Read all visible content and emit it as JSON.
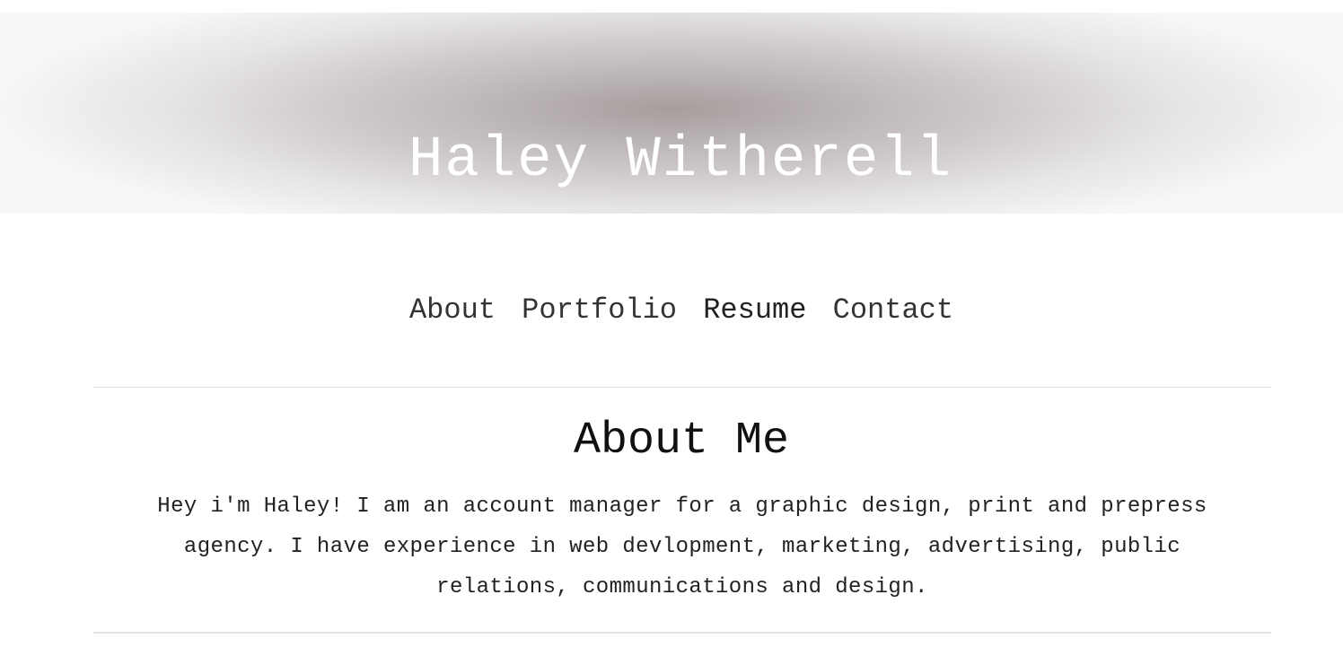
{
  "hero": {
    "title": "Haley Witherell"
  },
  "nav": {
    "items": [
      {
        "label": "About"
      },
      {
        "label": "Portfolio"
      },
      {
        "label": "Resume"
      },
      {
        "label": "Contact"
      }
    ]
  },
  "about": {
    "heading": "About Me",
    "text": "Hey i'm Haley! I am an account manager for a graphic design, print and prepress agency. I have experience in web devlopment, marketing, advertising, public relations, communications and design."
  },
  "colors": {
    "hero_center": "#a79e9e",
    "hero_edge": "#f7f7f7",
    "text": "#222222",
    "rule": "#e0e0e0"
  }
}
